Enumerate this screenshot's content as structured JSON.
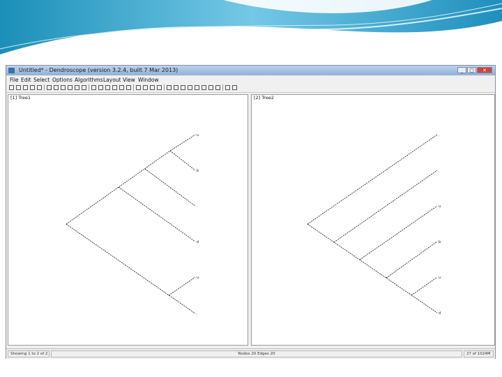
{
  "window": {
    "title": "Untitled* - Dendroscope (version 3.2.4, built 7 Mar 2013)",
    "controls": [
      "_",
      "□",
      "✕"
    ]
  },
  "menu": [
    "File",
    "Edit",
    "Select",
    "Options",
    "Algorithms",
    "Layout",
    "View",
    "Window"
  ],
  "toolbar": {
    "icons": [
      "back-icon",
      "forward-icon",
      "open-icon",
      "save-icon",
      "print-icon",
      "copy-icon",
      "paste-icon",
      "grid-icon",
      "tree-icon",
      "rotate-left-icon",
      "rotate-right-icon",
      "zoom-in-icon",
      "zoom-out-icon",
      "expand-icon",
      "contract-icon",
      "reroot-icon",
      "swap-icon",
      "layout-rect-icon",
      "layout-slanted-icon",
      "layout-circular-icon",
      "layout-radial-icon",
      "find-icon",
      "label-icon",
      "font-icon",
      "color-icon",
      "edge-icon",
      "node-icon",
      "collapse-icon",
      "uncollapse-icon",
      "minus-icon",
      "plus-icon"
    ]
  },
  "panels": {
    "left": {
      "label": "[1] Tree1"
    },
    "right": {
      "label": "[2] Tree2"
    }
  },
  "statusbar": {
    "left": "Showing 1 to 2 of 2",
    "center": "Nodes 20 Edges 20",
    "right": "27 of 1024M"
  },
  "colors": {
    "tree_line": "#111111",
    "window_chrome": "#f0f0f0",
    "titlebar": "#9fbde3"
  }
}
